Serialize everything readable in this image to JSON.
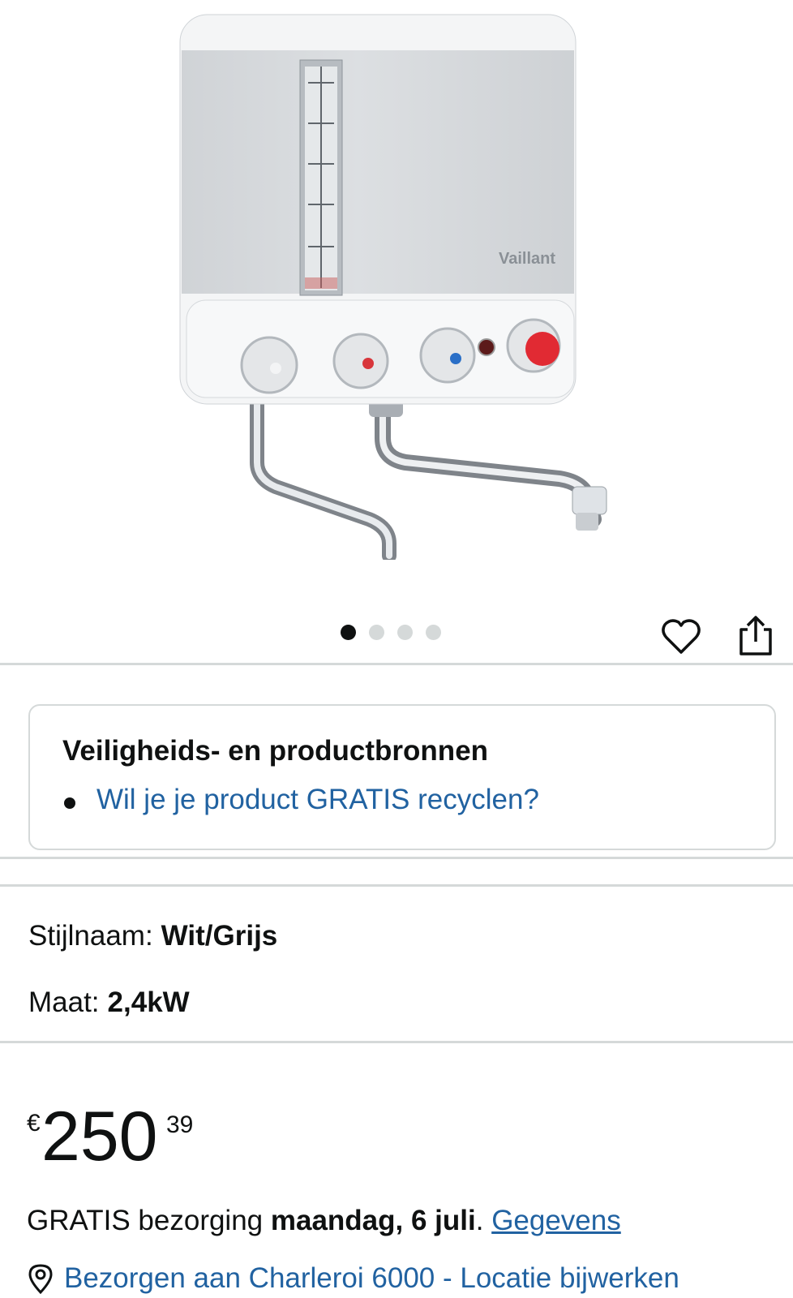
{
  "product": {
    "brand_mark": "Vaillant"
  },
  "carousel": {
    "count": 4,
    "active_index": 0
  },
  "safety": {
    "title": "Veiligheids- en productbronnen",
    "link": "Wil je je product GRATIS recyclen?"
  },
  "attributes": {
    "style_label": "Stijlnaam:",
    "style_value": "Wit/Grijs",
    "size_label": "Maat:",
    "size_value": "2,4kW"
  },
  "price": {
    "currency": "€",
    "whole": "250",
    "fraction": "39"
  },
  "delivery": {
    "prefix": "GRATIS bezorging ",
    "date": "maandag, 6 juli",
    "suffix": ". ",
    "details_link": "Gegevens"
  },
  "location": {
    "text": "Bezorgen aan Charleroi 6000 - Locatie bijwerken"
  },
  "colors": {
    "link": "#2162a1",
    "text": "#0f1111",
    "border": "#d5d9d9"
  },
  "icons": [
    "heart-icon",
    "share-icon",
    "location-pin-icon"
  ]
}
